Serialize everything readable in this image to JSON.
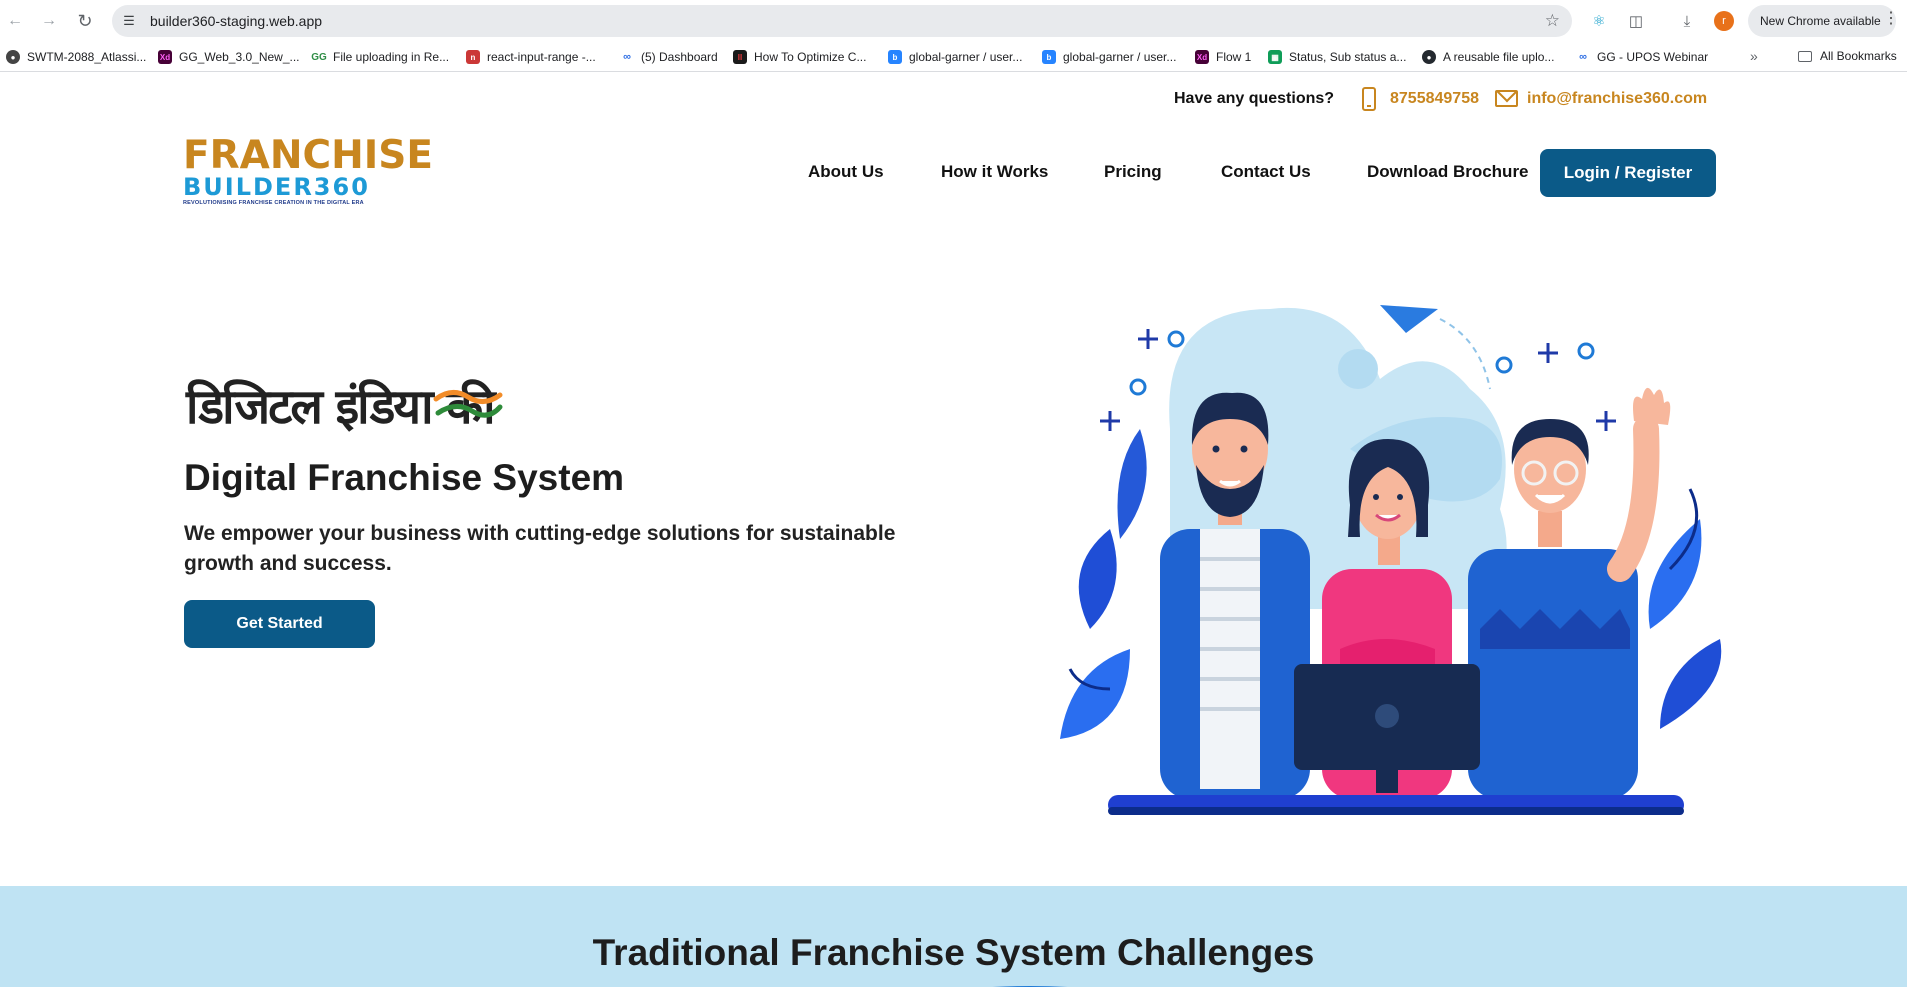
{
  "browser": {
    "url": "builder360-staging.web.app",
    "profile_initial": "r",
    "update_chip": "New Chrome available",
    "bookmarks": [
      {
        "label": "SWTM-2088_Atlassi...",
        "icon": "atlassian-icon"
      },
      {
        "label": "GG_Web_3.0_New_...",
        "icon": "xd-icon"
      },
      {
        "label": "File uploading in Re...",
        "icon": "geeks-icon"
      },
      {
        "label": "react-input-range -...",
        "icon": "npm-icon"
      },
      {
        "label": "(5) Dashboard",
        "icon": "dashboard-icon"
      },
      {
        "label": "How To Optimize C...",
        "icon": "optimize-icon"
      },
      {
        "label": "global-garner / user...",
        "icon": "bitbucket-icon"
      },
      {
        "label": "global-garner / user...",
        "icon": "bitbucket-icon"
      },
      {
        "label": "Flow 1",
        "icon": "xd-icon"
      },
      {
        "label": "Status, Sub status a...",
        "icon": "sheets-icon"
      },
      {
        "label": "A reusable file uplo...",
        "icon": "github-icon"
      },
      {
        "label": "GG - UPOS Webinar",
        "icon": "webinar-icon"
      }
    ],
    "all_bookmarks": "All Bookmarks"
  },
  "contact": {
    "question": "Have any questions?",
    "phone": "8755849758",
    "email": "info@franchise360.com"
  },
  "logo": {
    "line1": "FRANCHISE",
    "line2": "BUILDER360",
    "tagline": "REVOLUTIONISING FRANCHISE CREATION IN THE DIGITAL ERA"
  },
  "nav": {
    "about": "About Us",
    "how": "How it Works",
    "pricing": "Pricing",
    "contact": "Contact Us",
    "brochure": "Download Brochure",
    "login": "Login / Register"
  },
  "hero": {
    "hindi_text": "डिजिटल इंडिया की",
    "title": "Digital Franchise System",
    "subtitle": "We empower your business with cutting-edge solutions for sustainable growth and success.",
    "cta": "Get Started"
  },
  "challenges": {
    "title": "Traditional Franchise System Challenges"
  },
  "colors": {
    "brand_gold": "#c8861f",
    "brand_blue": "#0b5a88",
    "logo_blue": "#1d9ad6",
    "section_bg": "#bfe3f3"
  }
}
